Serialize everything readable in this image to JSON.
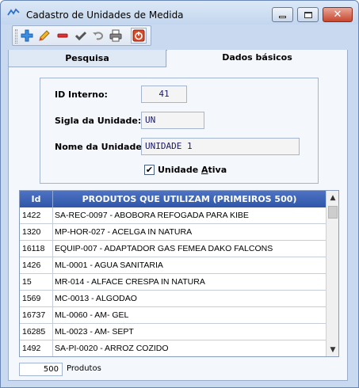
{
  "window": {
    "title": "Cadastro de Unidades de Medida",
    "icon": "chart-line-icon"
  },
  "toolbar": {
    "buttons": [
      {
        "name": "add-icon",
        "color": "#2a7fd6"
      },
      {
        "name": "edit-pencil-icon",
        "color": "#e0a020"
      },
      {
        "name": "remove-icon",
        "color": "#d42a2a"
      },
      {
        "name": "confirm-check-icon",
        "color": "#555555"
      },
      {
        "name": "undo-icon",
        "color": "#888888"
      },
      {
        "name": "print-icon",
        "color": "#666666"
      },
      {
        "name": "exit-icon",
        "color": "#d23a1a"
      }
    ]
  },
  "tabs": [
    {
      "label": "Pesquisa",
      "active": false
    },
    {
      "label": "Dados básicos",
      "active": true
    }
  ],
  "form": {
    "id_label": "ID Interno:",
    "id_value": "41",
    "sigla_label": "Sigla da Unidade:",
    "sigla_value": "UN",
    "nome_label": "Nome da Unidade:",
    "nome_value": "UNIDADE 1",
    "ativa_label_prefix": "Unidade ",
    "ativa_label_accel": "A",
    "ativa_label_suffix": "tiva",
    "ativa_checked": true
  },
  "grid": {
    "col_id": "Id",
    "col_produto": "PRODUTOS QUE UTILIZAM (PRIMEIROS 500)",
    "header_color": "#3a62b8",
    "rows": [
      {
        "id": "1422",
        "produto": "SA-REC-0097 - ABOBORA REFOGADA PARA KIBE"
      },
      {
        "id": "1320",
        "produto": "MP-HOR-027 - ACELGA IN NATURA"
      },
      {
        "id": "16118",
        "produto": "EQUIP-007 - ADAPTADOR GAS FEMEA DAKO FALCONS"
      },
      {
        "id": "1426",
        "produto": "ML-0001 - AGUA SANITARIA"
      },
      {
        "id": "15",
        "produto": "MR-014 - ALFACE CRESPA IN NATURA"
      },
      {
        "id": "1569",
        "produto": "MC-0013 - ALGODAO"
      },
      {
        "id": "16737",
        "produto": "ML-0060 - AM- GEL"
      },
      {
        "id": "16285",
        "produto": "ML-0023 - AM- SEPT"
      },
      {
        "id": "1492",
        "produto": "SA-PI-0020 - ARROZ COZIDO"
      }
    ]
  },
  "footer": {
    "count": "500",
    "count_label": "Produtos"
  }
}
